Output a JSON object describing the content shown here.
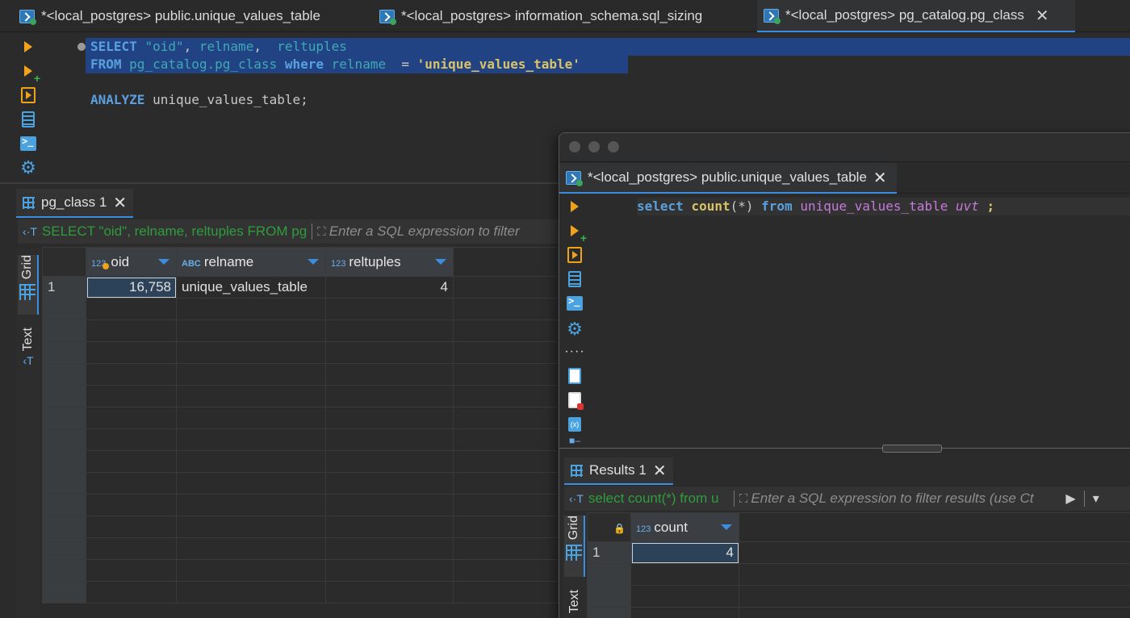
{
  "tabs": [
    {
      "label": "*<local_postgres> public.unique_values_table",
      "active": false
    },
    {
      "label": "*<local_postgres> information_schema.sql_sizing",
      "active": false
    },
    {
      "label": "*<local_postgres> pg_catalog.pg_class",
      "active": true,
      "close": "✕"
    }
  ],
  "editor": {
    "line1": {
      "kw1": "SELECT",
      "s1": "\"oid\"",
      "comma1": ",",
      "c2": "relname",
      "comma2": ",",
      "c3": "reltuples"
    },
    "line2": {
      "kw1": "FROM",
      "t": "pg_catalog.pg_class",
      "kw2": "where",
      "col": "relname",
      "op": "=",
      "val": "'unique_values_table'"
    },
    "line3": {
      "kw": "ANALYZE",
      "rest": "unique_values_table;"
    }
  },
  "results_left": {
    "tab_label": "pg_class 1",
    "tab_close": "✕",
    "filter_query": "SELECT \"oid\", relname, reltuples FROM pg",
    "filter_placeholder": "Enter a SQL expression to filter",
    "side_tabs": [
      "Grid",
      "Text"
    ],
    "columns": [
      {
        "type": "123",
        "name": "oid"
      },
      {
        "type": "ABC",
        "name": "relname"
      },
      {
        "type": "123",
        "name": "reltuples"
      }
    ],
    "rows": [
      {
        "num": "1",
        "oid": "16,758",
        "relname": "unique_values_table",
        "reltuples": "4"
      }
    ]
  },
  "window": {
    "tab_label": "*<local_postgres> public.unique_values_table",
    "tab_close": "✕",
    "code": {
      "kw1": "select",
      "fn": "count",
      "args": "(*)",
      "kw2": "from",
      "tbl": "unique_values_table",
      "alias": "uvt",
      "semi": ";"
    },
    "results": {
      "tab_label": "Results 1",
      "tab_close": "✕",
      "filter_query": "select count(*) from u",
      "filter_placeholder": "Enter a SQL expression to filter results (use Ct",
      "side_tabs": [
        "Grid",
        "Text"
      ],
      "columns": [
        {
          "type": "123",
          "name": "count"
        }
      ],
      "rows": [
        {
          "num": "1",
          "count": "4"
        }
      ]
    }
  }
}
